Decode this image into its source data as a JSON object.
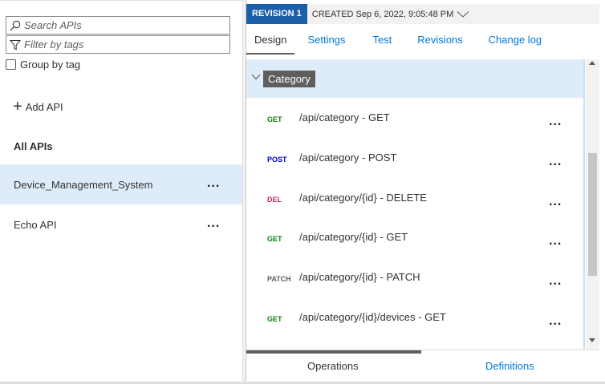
{
  "left_pane": {
    "search": {
      "placeholder": "Search APIs",
      "icon": "search-icon"
    },
    "filter": {
      "placeholder": "Filter by tags",
      "icon": "filter-icon"
    },
    "group_by_tag": {
      "label": "Group by tag",
      "checked": false
    },
    "add_api": {
      "label": "Add API",
      "icon": "plus-icon"
    },
    "section_title": "All APIs",
    "apis": [
      {
        "name": "Device_Management_System",
        "selected": true,
        "more": "..."
      },
      {
        "name": "Echo API",
        "selected": false,
        "more": "..."
      }
    ]
  },
  "revision_bar": {
    "badge": "REVISION 1",
    "created": "CREATED Sep 6, 2022, 9:05:48 PM",
    "icon": "chevron-down-icon"
  },
  "tabs": [
    {
      "label": "Design",
      "active": true
    },
    {
      "label": "Settings",
      "active": false
    },
    {
      "label": "Test",
      "active": false
    },
    {
      "label": "Revisions",
      "active": false
    },
    {
      "label": "Change log",
      "active": false
    }
  ],
  "operations_panel": {
    "category": "Category",
    "operations": [
      {
        "method": "GET",
        "method_color": "#107c10",
        "path": "/api/category - GET",
        "more": "..."
      },
      {
        "method": "POST",
        "method_color": "#0000cc",
        "path": "/api/category - POST",
        "more": "..."
      },
      {
        "method": "DEL",
        "method_color": "#c4314b",
        "path": "/api/category/{id} - DELETE",
        "more": "..."
      },
      {
        "method": "GET",
        "method_color": "#107c10",
        "path": "/api/category/{id} - GET",
        "more": "..."
      },
      {
        "method": "PATCH",
        "method_color": "#605e5c",
        "path": "/api/category/{id} - PATCH",
        "more": "..."
      },
      {
        "method": "GET",
        "method_color": "#107c10",
        "path": "/api/category/{id}/devices - GET",
        "more": "..."
      }
    ]
  },
  "bottom_tabs": [
    {
      "label": "Operations",
      "active": true
    },
    {
      "label": "Definitions",
      "active": false
    }
  ],
  "colors": {
    "accent": "#0078d4",
    "selected_bg": "#deecf9",
    "revision_badge": "#1b5fa8"
  }
}
